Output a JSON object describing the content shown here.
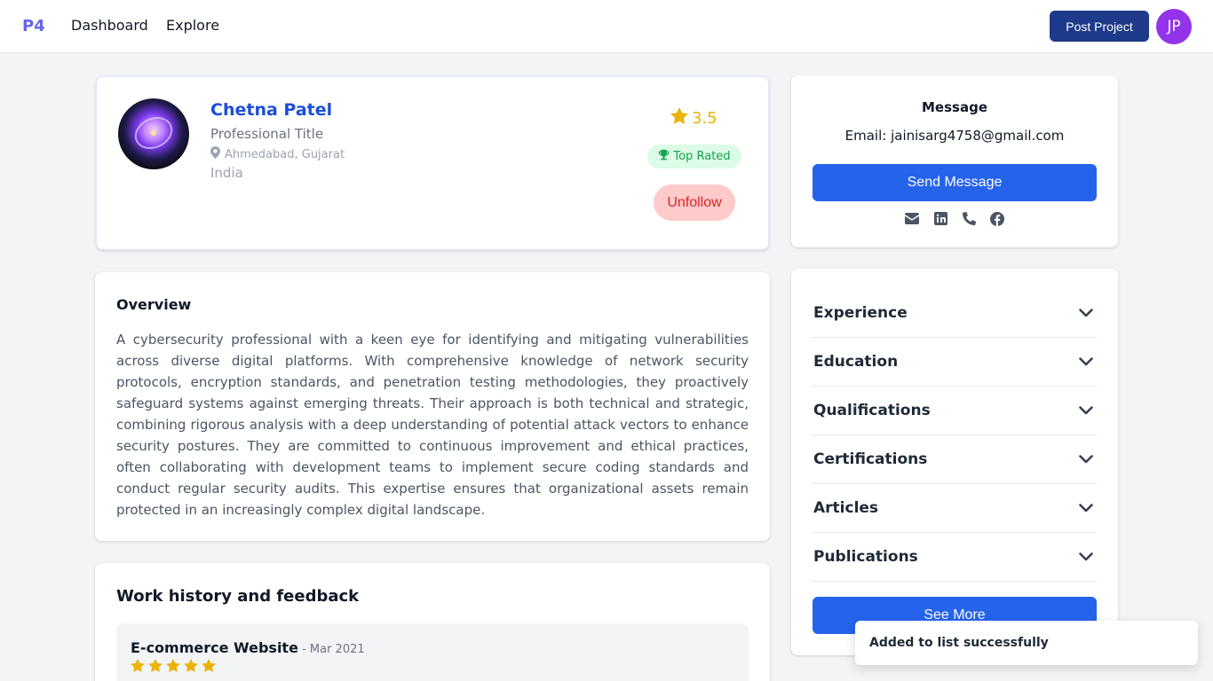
{
  "nav": {
    "logo": "P4",
    "links": [
      "Dashboard",
      "Explore"
    ],
    "post_project": "Post Project",
    "user_initials": "JP",
    "avatar_color": "#9333ea"
  },
  "profile": {
    "name": "Chetna Patel",
    "title": "Professional Title",
    "location": "Ahmedabad, Gujarat",
    "country": "India",
    "rating": "3.5",
    "badge": "Top Rated",
    "unfollow": "Unfollow"
  },
  "message": {
    "title": "Message",
    "email": "Email: jainisarg4758@gmail.com",
    "send": "Send Message",
    "social_icons": [
      "envelope-icon",
      "linkedin-icon",
      "phone-icon",
      "facebook-icon"
    ]
  },
  "overview": {
    "title": "Overview",
    "text": "A cybersecurity professional with a keen eye for identifying and mitigating vulnerabilities across diverse digital platforms. With comprehensive knowledge of network security protocols, encryption standards, and penetration testing methodologies, they proactively safeguard systems against emerging threats. Their approach is both technical and strategic, combining rigorous analysis with a deep understanding of potential attack vectors to enhance security postures. They are committed to continuous improvement and ethical practices, often collaborating with development teams to implement secure coding standards and conduct regular security audits. This expertise ensures that organizational assets remain protected in an increasingly complex digital landscape."
  },
  "sections": {
    "items": [
      "Experience",
      "Education",
      "Qualifications",
      "Certifications",
      "Articles",
      "Publications"
    ],
    "see_more": "See More"
  },
  "work_history": {
    "title": "Work history and feedback",
    "items": [
      {
        "name": "E-commerce Website",
        "date": " - Mar 2021",
        "stars": 5
      }
    ]
  },
  "toast": {
    "text": "Added to list successfully"
  },
  "colors": {
    "accent": "#2563eb",
    "brand_dark": "#1e3a8a",
    "rating": "#eab308",
    "badge_bg": "#dcfce7",
    "badge_text": "#16a34a",
    "unfollow_bg": "#fecaca",
    "unfollow_text": "#dc2626"
  }
}
